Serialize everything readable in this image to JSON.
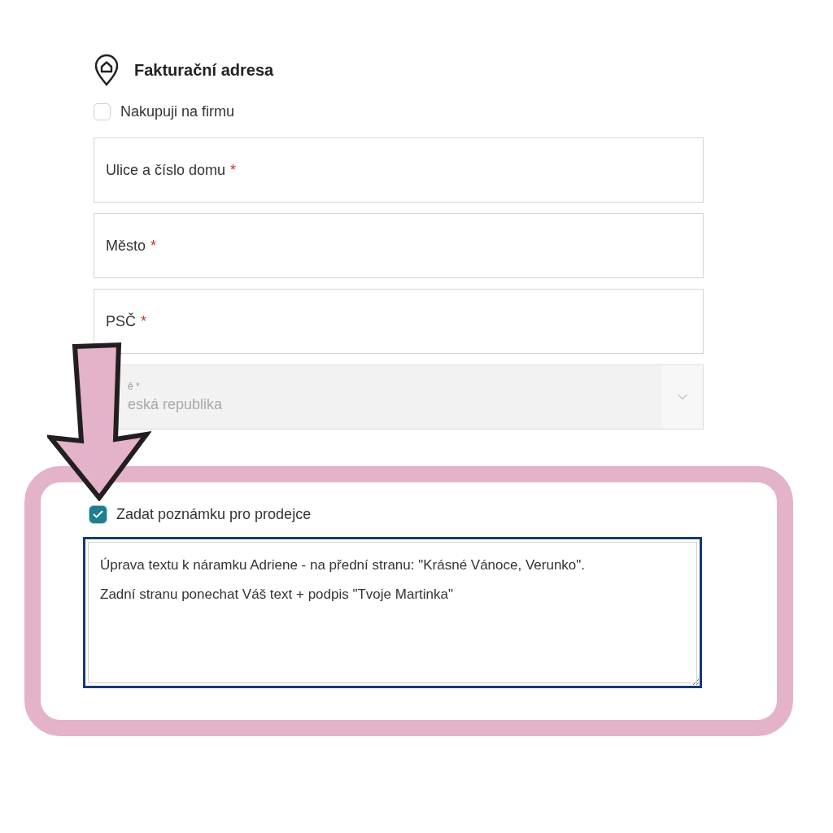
{
  "heading": {
    "title": "Fakturační adresa"
  },
  "company_checkbox": {
    "label": "Nakupuji na firmu",
    "checked": false
  },
  "fields": [
    {
      "label": "Ulice a číslo domu",
      "required_mark": "*"
    },
    {
      "label": "Město",
      "required_mark": "*"
    },
    {
      "label": "PSČ",
      "required_mark": "*"
    }
  ],
  "country_select": {
    "label": "ě *",
    "value": "eská republika",
    "disabled": true
  },
  "note_checkbox": {
    "label": "Zadat poznámku pro prodejce",
    "checked": true
  },
  "note": {
    "value": "Úprava textu k náramku Adriene - na přední stranu: \"Krásné Vánoce, Verunko\".\nZadní stranu ponechat Váš text + podpis \"Tvoje Martinka\""
  }
}
